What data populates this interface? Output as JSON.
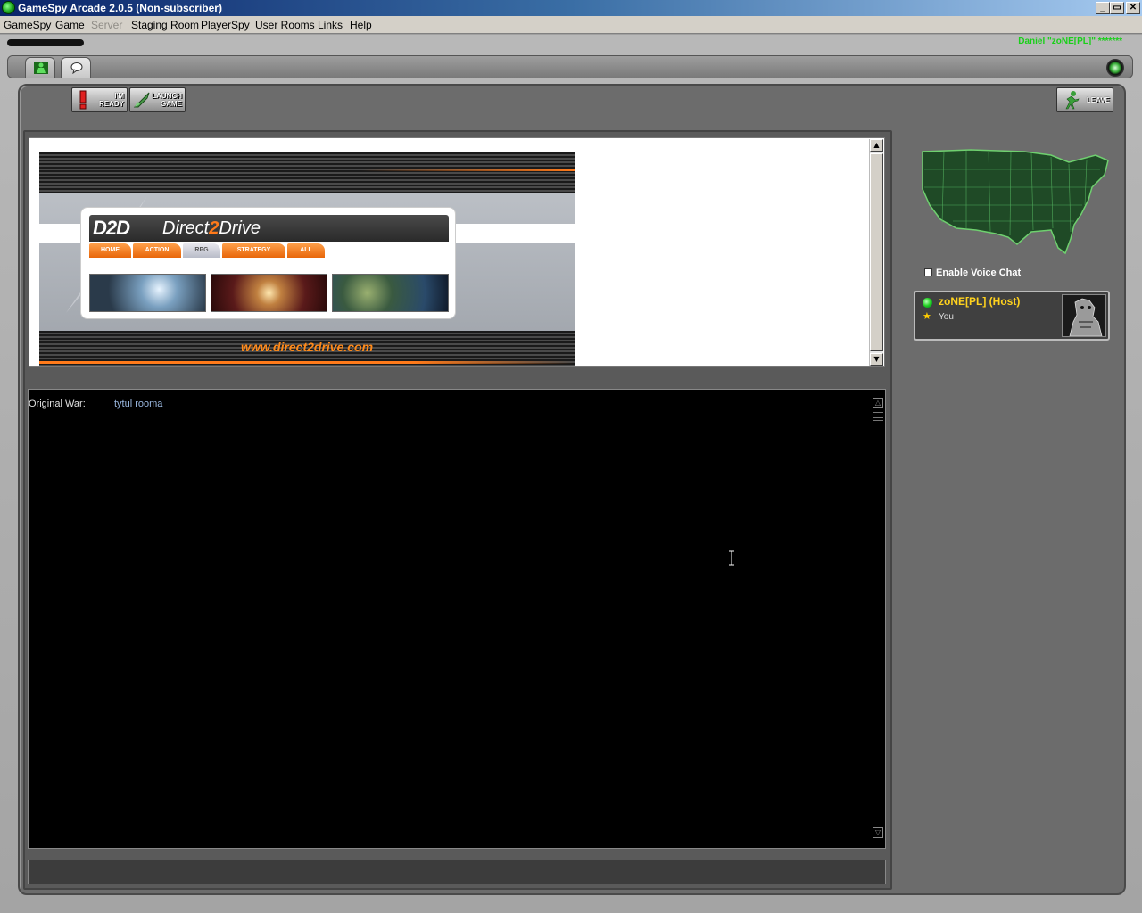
{
  "window": {
    "title": "GameSpy Arcade 2.0.5 (Non-subscriber)",
    "controls": {
      "minimize": "_",
      "restore": "▭",
      "close": "✕"
    }
  },
  "menu": {
    "items": [
      {
        "label": "GameSpy",
        "enabled": true
      },
      {
        "label": "Game",
        "enabled": true
      },
      {
        "label": "Server",
        "enabled": false
      },
      {
        "label": "Staging Room",
        "enabled": true
      },
      {
        "label": "PlayerSpy",
        "enabled": true
      },
      {
        "label": "User Rooms",
        "enabled": true
      },
      {
        "label": "Links",
        "enabled": true
      },
      {
        "label": "Help",
        "enabled": true
      }
    ]
  },
  "header": {
    "user_label": "Daniel \"zoNE[PL]\" *******"
  },
  "toolbar": {
    "ready_label": "I'm Ready",
    "launch_label": "Launch Game",
    "leave_label": "Leave"
  },
  "ad": {
    "logo": "D2D",
    "brand_a": "Direct",
    "brand_b": "2",
    "brand_c": "Drive",
    "nav": [
      "HOME",
      "ACTION",
      "RPG",
      "STRATEGY",
      "ALL"
    ],
    "nav_selected": "RPG",
    "url": "www.direct2drive.com"
  },
  "chat": {
    "lines": [
      {
        "who": "Original War:",
        "msg": "tytul rooma"
      }
    ],
    "input_value": ""
  },
  "voice_chat": {
    "label": "Enable Voice Chat",
    "checked": false
  },
  "players": [
    {
      "name": "zoNE[PL] (Host)",
      "note": "You",
      "status_color": "#1fcf1f"
    }
  ],
  "colors": {
    "accent_green": "#19d019",
    "host_yellow": "#ffd21e",
    "ad_orange": "#ff7a1a",
    "chat_msg": "#9ab8e0"
  }
}
